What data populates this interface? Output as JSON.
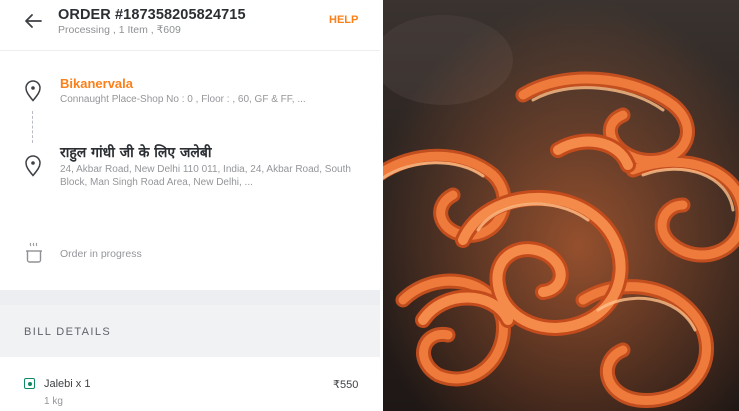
{
  "header": {
    "order_title": "ORDER #187358205824715",
    "order_subtitle": "Processing , 1 Item , ₹609",
    "help_label": "HELP"
  },
  "restaurant": {
    "name": "Bikanervala",
    "address": "Connaught Place-Shop No : 0 , Floor : , 60, GF & FF, ..."
  },
  "delivery": {
    "name": "राहुल गांधी जी के लिए जलेबी",
    "address": "24, Akbar Road, New Delhi 110 011, India, 24, Akbar Road, South Block, Man Singh Road Area, New Delhi, ..."
  },
  "status": {
    "text": "Order in progress"
  },
  "bill": {
    "title": "BILL DETAILS",
    "items": [
      {
        "name": "Jalebi x 1",
        "qty": "1 kg",
        "price": "₹550"
      }
    ]
  },
  "colors": {
    "accent": "#fc8019",
    "veg": "#0f8a65",
    "text_primary": "#2b2f33",
    "text_secondary": "#93969a"
  },
  "photo": {
    "subject": "jalebi-photo"
  }
}
